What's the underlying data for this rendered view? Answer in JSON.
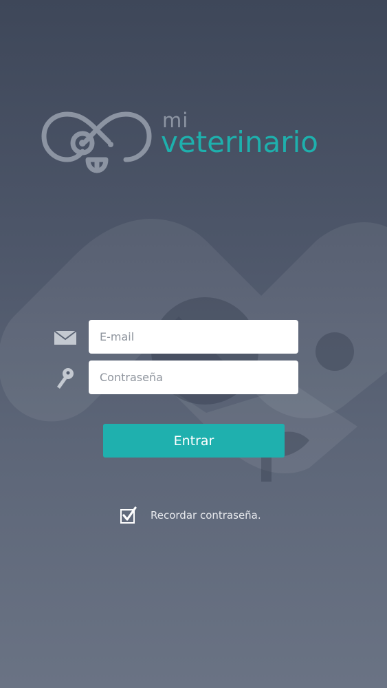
{
  "brand": {
    "prefix": "mi",
    "name": "veterinario",
    "accent_color": "#1eb0ad",
    "logo_icon": "dog-face-icon"
  },
  "form": {
    "email": {
      "icon": "envelope-icon",
      "value": "",
      "placeholder": "E-mail"
    },
    "password": {
      "icon": "key-icon",
      "value": "",
      "placeholder": "Contraseña"
    },
    "submit_label": "Entrar",
    "remember": {
      "checked": true,
      "label": "Recordar contraseña."
    }
  }
}
